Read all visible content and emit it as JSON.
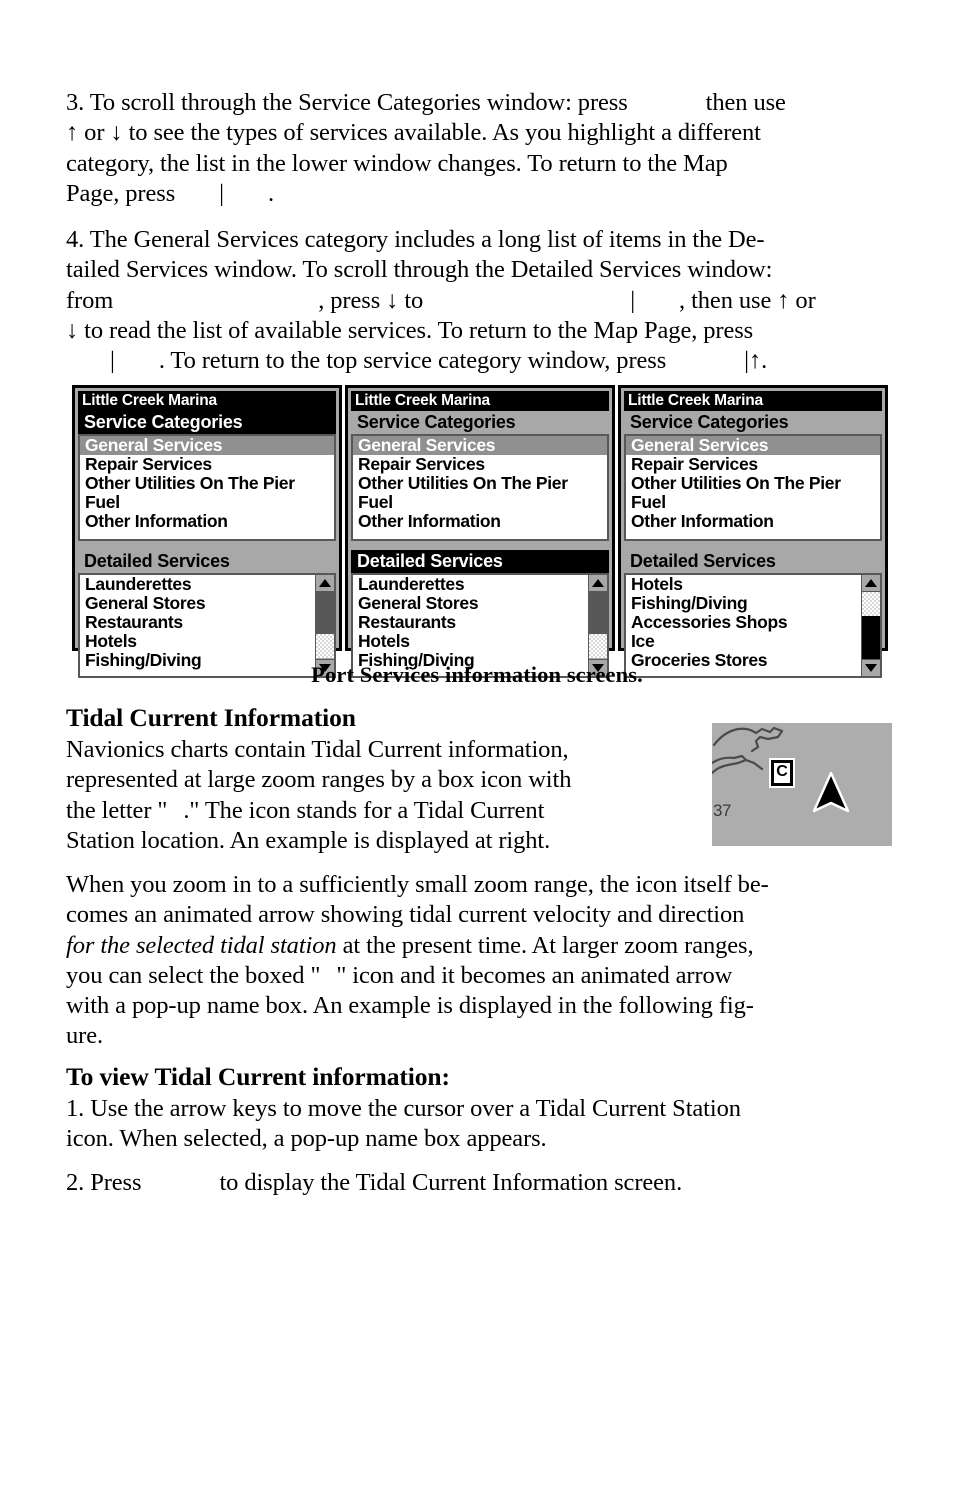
{
  "document": {
    "paragraph3": {
      "prefix": "3. To scroll through the Service Categories window: press",
      "mid1": "then use",
      "line2": "↑ or ↓ to see the types of services available. As you highlight a different",
      "line3": "category, the list in the lower window changes. To return to the Map",
      "line4_prefix": "Page, press",
      "line4_bar": "|",
      "line4_suffix": "."
    },
    "paragraph4": {
      "line1": "4. The General Services category includes a long list of items in the De-",
      "line2": "tailed Services window. To scroll through the Detailed Services window:",
      "line3_a": "from",
      "line3_b": ", press ↓ to",
      "line3_bar": "|",
      "line3_c": ", then use ↑ or",
      "line4": "↓ to read the list of available services. To return to the Map Page, press",
      "line5_bar": "|",
      "line5_a": ". To return to the top service category window, press",
      "line5_b": "|↑."
    },
    "figure_caption": "Port Services information screens.",
    "tidal_heading": "Tidal Current Information",
    "tidal_para1": {
      "line1": "Navionics charts contain Tidal Current information,",
      "line2": "represented at large zoom ranges by a box icon with",
      "line3_a": "the letter \"",
      "line3_b": ".\" The icon stands for a Tidal Current",
      "line4": "Station location. An example is displayed at right."
    },
    "tidal_para2": {
      "line1": "When you zoom in to a sufficiently small zoom range, the icon itself be-",
      "line2": "comes an animated arrow showing tidal current velocity and direction",
      "line3_italic": "for the selected tidal station",
      "line3_rest": "at the present time. At larger zoom ranges,",
      "line4_a": "you can select the boxed \"",
      "line4_b": "\" icon and it becomes an animated arrow",
      "line5": "with a pop-up name box. An example is displayed in the following fig-",
      "line6": "ure."
    },
    "view_heading": "To view Tidal Current information:",
    "step1": {
      "line1": "1. Use the arrow keys to move the cursor over a Tidal Current Station",
      "line2": "icon. When selected, a pop-up name box appears."
    },
    "step2": {
      "prefix": "2. Press",
      "suffix": "to display the Tidal Current Information screen."
    }
  },
  "screens": [
    {
      "title": "Little Creek Marina",
      "categories_header": "Service Categories",
      "categories_header_state": "active",
      "categories": [
        {
          "label": "General Services",
          "selected": true
        },
        {
          "label": "Repair Services",
          "selected": false
        },
        {
          "label": "Other Utilities On The Pier",
          "selected": false
        },
        {
          "label": "Fuel",
          "selected": false
        },
        {
          "label": "Other Information",
          "selected": false
        }
      ],
      "detailed_header": "Detailed Services",
      "detailed_header_state": "inactive",
      "detailed": [
        "Launderettes",
        "General Stores",
        "Restaurants",
        "Hotels",
        "Fishing/Diving"
      ],
      "scroll_thumb_position": "top"
    },
    {
      "title": "Little Creek Marina",
      "categories_header": "Service Categories",
      "categories_header_state": "inactive",
      "categories": [
        {
          "label": "General Services",
          "selected": true
        },
        {
          "label": "Repair Services",
          "selected": false
        },
        {
          "label": "Other Utilities On The Pier",
          "selected": false
        },
        {
          "label": "Fuel",
          "selected": false
        },
        {
          "label": "Other Information",
          "selected": false
        }
      ],
      "detailed_header": "Detailed Services",
      "detailed_header_state": "active",
      "detailed": [
        "Launderettes",
        "General Stores",
        "Restaurants",
        "Hotels",
        "Fishing/Diving"
      ],
      "scroll_thumb_position": "top"
    },
    {
      "title": "Little Creek Marina",
      "categories_header": "Service Categories",
      "categories_header_state": "inactive",
      "categories": [
        {
          "label": "General Services",
          "selected": true
        },
        {
          "label": "Repair Services",
          "selected": false
        },
        {
          "label": "Other Utilities On The Pier",
          "selected": false
        },
        {
          "label": "Fuel",
          "selected": false
        },
        {
          "label": "Other Information",
          "selected": false
        }
      ],
      "detailed_header": "Detailed Services",
      "detailed_header_state": "inactive",
      "detailed": [
        "Hotels",
        "Fishing/Diving",
        "Accessories Shops",
        "Ice",
        "Groceries Stores"
      ],
      "scroll_thumb_position": "middle"
    }
  ],
  "map_figure": {
    "tidal_station_letter": "C",
    "depth_label": "37",
    "background_color": "#adadad"
  }
}
